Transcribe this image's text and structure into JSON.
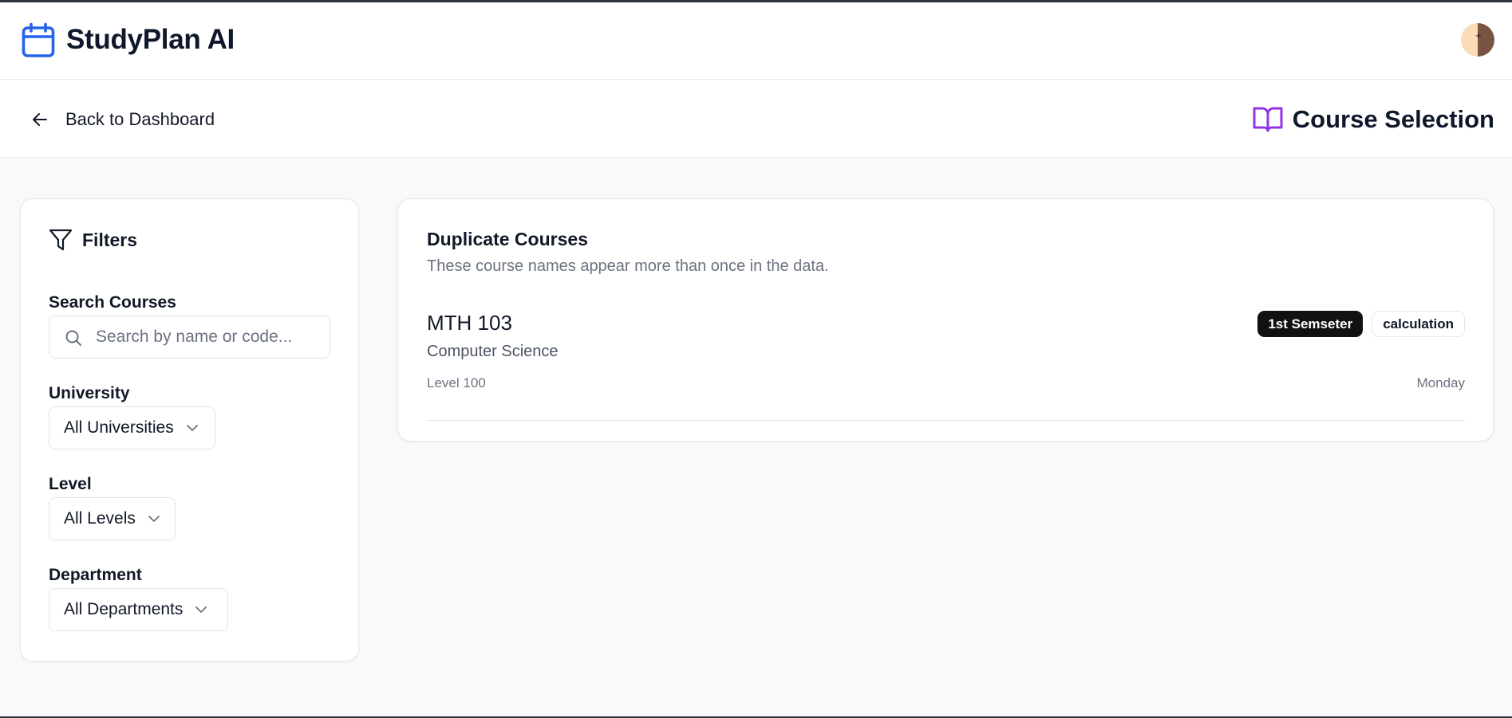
{
  "header": {
    "app_title": "StudyPlan AI",
    "brand_color": "#2563eb",
    "brand_icon": "calendar-icon",
    "avatar_mark": "+"
  },
  "subnav": {
    "back_label": "Back to Dashboard",
    "page_title": "Course Selection",
    "page_icon": "book-open-icon",
    "page_icon_color": "#9333ea"
  },
  "filters": {
    "title": "Filters",
    "search": {
      "label": "Search Courses",
      "value": "",
      "placeholder": "Search by name or code..."
    },
    "university": {
      "label": "University",
      "selected": "All Universities"
    },
    "level": {
      "label": "Level",
      "selected": "All Levels"
    },
    "department": {
      "label": "Department",
      "selected": "All Departments"
    }
  },
  "duplicates": {
    "title": "Duplicate Courses",
    "description": "These course names appear more than once in the data.",
    "courses": [
      {
        "code": "MTH 103",
        "department": "Computer Science",
        "level": "Level 100",
        "day": "Monday",
        "badges": [
          "1st Semseter",
          "calculation"
        ]
      }
    ]
  }
}
